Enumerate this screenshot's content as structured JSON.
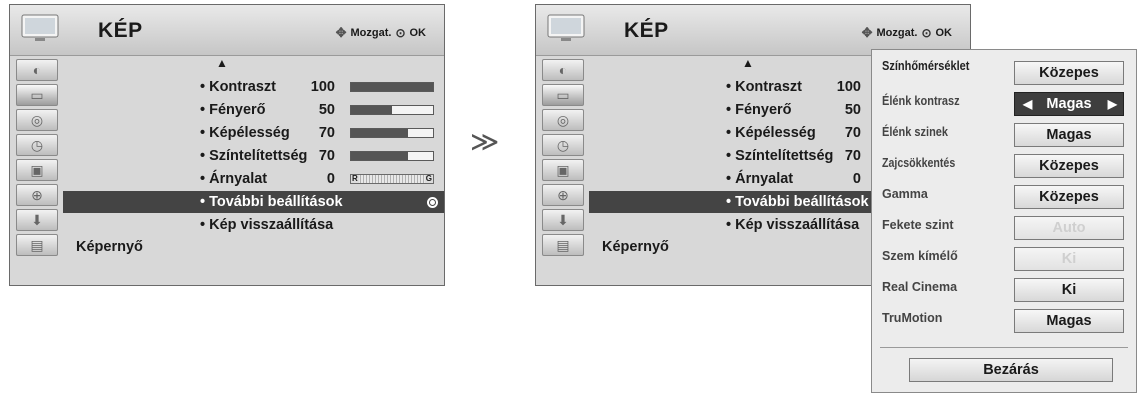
{
  "menu": {
    "title": "KÉP",
    "hint_move": "Mozgat.",
    "hint_ok": "OK",
    "items": [
      {
        "label": "• Kontraszt",
        "value": "100",
        "level": 100
      },
      {
        "label": "• Fényerő",
        "value": "50",
        "level": 50
      },
      {
        "label": "• Képélesség",
        "value": "70",
        "level": 70
      },
      {
        "label": "• Színtelítettség",
        "value": "70",
        "level": 70
      },
      {
        "label": "• Árnyalat",
        "value": "0",
        "balance_left": "R",
        "balance_right": "G"
      },
      {
        "label": "• További beállítások"
      },
      {
        "label": "• Kép visszaállítása"
      }
    ],
    "screen_label": "Képernyő",
    "sidebar_icons": [
      "picture-mode-icon",
      "picture-icon",
      "audio-icon",
      "time-icon",
      "option-icon",
      "lock-icon",
      "input-icon",
      "usb-icon"
    ]
  },
  "popup": {
    "rows": [
      {
        "label": "Színhőmérséklet",
        "value": "Közepes",
        "state": "normal"
      },
      {
        "label": "Élénk kontrasz",
        "value": "Magas",
        "state": "selected"
      },
      {
        "label": "Élénk szinek",
        "value": "Magas",
        "state": "normal"
      },
      {
        "label": "Zajcsökkentés",
        "value": "Közepes",
        "state": "normal"
      },
      {
        "label": "Gamma",
        "value": "Közepes",
        "state": "normal"
      },
      {
        "label": "Fekete szint",
        "value": "Auto",
        "state": "disabled"
      },
      {
        "label": "Szem kímélő",
        "value": "Ki",
        "state": "disabled"
      },
      {
        "label": "Real Cinema",
        "value": "Ki",
        "state": "normal"
      },
      {
        "label": "TruMotion",
        "value": "Magas",
        "state": "normal"
      }
    ],
    "close_label": "Bezárás"
  },
  "transition_arrow": "≫"
}
